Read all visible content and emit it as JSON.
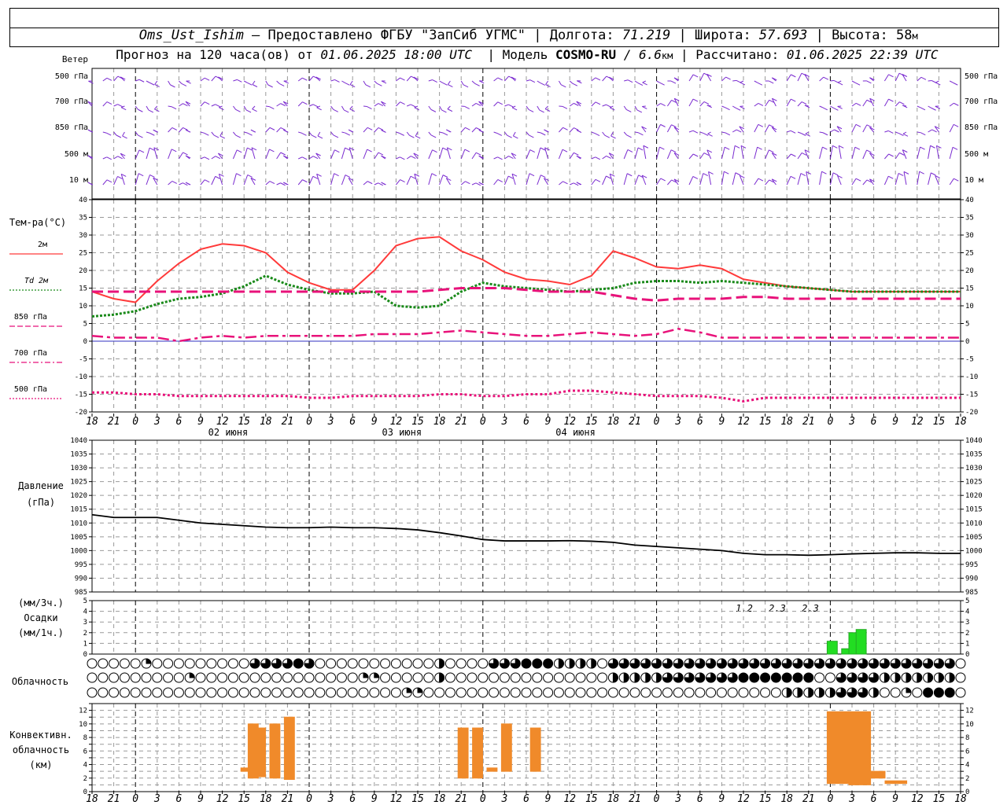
{
  "header": {
    "station": "Oms_Ust_Ishim",
    "sep1": " – ",
    "provided": "Предоставлено ФГБУ \"ЗапСиб УГМС\"",
    "lon_label": "Долгота: ",
    "lon_value": "71.219",
    "lat_label": "Широта: ",
    "lat_value": "57.693",
    "alt_label": "Высота: ",
    "alt_value": "58",
    "alt_unit": "м",
    "line2_a": "Прогноз на 120 часа(ов) от ",
    "line2_date": "01.06.2025 18:00 UTC",
    "line2_model_label": "Модель ",
    "line2_model": "COSMO-RU",
    "line2_res": " / 6.6",
    "line2_res_unit": "км",
    "line2_calc_label": "Рассчитано: ",
    "line2_calc": "01.06.2025 22:39 UTC"
  },
  "wind": {
    "title": "Ветер",
    "levels": [
      "500 гПа",
      "700 гПа",
      "850 гПа",
      "500 м",
      "10  м"
    ]
  },
  "temperature": {
    "title": "Тем-ра(°С)",
    "legend": [
      {
        "label": "2м",
        "color": "#ff3030"
      },
      {
        "label": "Td  2м",
        "color": "#1a8a1a"
      },
      {
        "label": "850 гПа",
        "color": "#e8127a"
      },
      {
        "label": "700 гПа",
        "color": "#e8127a"
      },
      {
        "label": "500 гПа",
        "color": "#e8127a"
      }
    ]
  },
  "x_axis": {
    "tick_labels": [
      "18",
      "21",
      "0",
      "3",
      "6",
      "9",
      "12",
      "15",
      "18",
      "21",
      "0",
      "3",
      "6",
      "9",
      "12",
      "15",
      "18",
      "21",
      "0",
      "3",
      "6",
      "9",
      "12",
      "15",
      "18",
      "21",
      "0"
    ],
    "days": [
      "02 июня",
      "03 июня",
      "04 июня"
    ]
  },
  "pressure": {
    "title1": "Давление",
    "title2": "(гПа)"
  },
  "precip": {
    "title1": "(мм/3ч.)",
    "title2": "Осадки",
    "title3": "(мм/1ч.)",
    "annotations": [
      "1.2",
      "2.3",
      "2.3"
    ]
  },
  "clouds": {
    "title": "Облачность"
  },
  "convective": {
    "title1": "Конвективн.",
    "title2": "облачность",
    "title3": "(км)"
  },
  "chart_data": [
    {
      "type": "line",
      "name": "temperature",
      "x_hours_from_start": [
        0,
        3,
        6,
        9,
        12,
        15,
        18,
        21,
        24,
        27,
        30,
        33,
        36,
        39,
        42,
        45,
        48,
        51,
        54,
        57,
        60,
        63,
        66,
        69,
        72,
        75,
        78,
        81,
        84,
        87,
        90,
        93,
        96,
        99,
        102,
        105,
        108,
        111,
        114,
        117,
        120
      ],
      "ylim": [
        -20,
        40
      ],
      "ylabel": "Тем-ра(°С)",
      "series": [
        {
          "name": "2м",
          "values": [
            14,
            12,
            11,
            17,
            22,
            26,
            27.5,
            27,
            25,
            19.5,
            16.5,
            14.5,
            14.5,
            20,
            27,
            29,
            29.5,
            25.5,
            23,
            19.5,
            17.5,
            17,
            16,
            18.5,
            25.5,
            23.5,
            21,
            20.5,
            21.5,
            20.5,
            17.5,
            16.5,
            15.5,
            15,
            14.5,
            14,
            14,
            14,
            14,
            14,
            14
          ]
        },
        {
          "name": "Td  2м",
          "values": [
            7,
            7.5,
            8.5,
            10.5,
            12,
            12.5,
            13.5,
            15.5,
            18.5,
            16,
            14.5,
            13.5,
            13.5,
            14,
            10,
            9.5,
            10,
            14,
            16.5,
            15.5,
            15,
            14.5,
            14,
            14.5,
            15,
            16.5,
            17,
            17,
            16.5,
            17,
            16.5,
            16,
            15.5,
            15,
            14.5,
            14,
            14,
            14,
            14,
            14,
            14
          ]
        },
        {
          "name": "850 гПа",
          "values": [
            14,
            14,
            14,
            14,
            14,
            14,
            14,
            14,
            14,
            14,
            14,
            14,
            14,
            14,
            14,
            14,
            14.5,
            15,
            15,
            15,
            14.5,
            14,
            14,
            14,
            13,
            12,
            11.5,
            12,
            12,
            12,
            12.5,
            12.5,
            12,
            12,
            12,
            12,
            12,
            12,
            12,
            12,
            12
          ]
        },
        {
          "name": "700 гПа",
          "values": [
            1.5,
            1,
            1,
            1,
            0,
            1,
            1.5,
            1,
            1.5,
            1.5,
            1.5,
            1.5,
            1.5,
            2,
            2,
            2,
            2.5,
            3,
            2.5,
            2,
            1.5,
            1.5,
            2,
            2.5,
            2,
            1.5,
            2,
            3.5,
            2.5,
            1,
            1,
            1,
            1,
            1,
            1,
            1,
            1,
            1,
            1,
            1,
            1
          ]
        },
        {
          "name": "500 гПа",
          "values": [
            -14.5,
            -14.5,
            -15,
            -15,
            -15.5,
            -15.5,
            -15.5,
            -15.5,
            -15.5,
            -15.5,
            -16,
            -16,
            -15.5,
            -15.5,
            -15.5,
            -15.5,
            -15,
            -15,
            -15.5,
            -15.5,
            -15,
            -15,
            -14,
            -14,
            -14.5,
            -15,
            -15.5,
            -15.5,
            -15.5,
            -16,
            -17,
            -16,
            -16,
            -16,
            -16,
            -16,
            -16,
            -16,
            -16,
            -16,
            -16
          ]
        }
      ]
    },
    {
      "type": "line",
      "name": "pressure",
      "x_hours_from_start": [
        0,
        3,
        6,
        9,
        12,
        15,
        18,
        21,
        24,
        27,
        30,
        33,
        36,
        39,
        42,
        45,
        48,
        51,
        54,
        57,
        60,
        63,
        66,
        69,
        72,
        75,
        78,
        81,
        84,
        87,
        90,
        93,
        96,
        99,
        102,
        105,
        108,
        111,
        114,
        117,
        120
      ],
      "ylim": [
        985,
        1040
      ],
      "values": [
        1013,
        1012,
        1012,
        1012,
        1011,
        1010,
        1009.5,
        1009,
        1008.5,
        1008.3,
        1008.3,
        1008.5,
        1008.3,
        1008.3,
        1008,
        1007.5,
        1006.5,
        1005.3,
        1004,
        1003.5,
        1003.5,
        1003.5,
        1003.6,
        1003.4,
        1003,
        1002,
        1001.5,
        1001,
        1000.5,
        1000,
        999,
        998.5,
        998.5,
        998.3,
        998.5,
        998.8,
        999,
        999.2,
        999.2,
        999,
        999
      ]
    },
    {
      "type": "bar",
      "name": "precipitation",
      "x_hours_from_start": [
        102,
        104,
        105,
        106
      ],
      "ylim": [
        0,
        5
      ],
      "values": [
        1.2,
        0.5,
        2.0,
        2.3
      ]
    },
    {
      "type": "bar",
      "name": "convective_cloud",
      "ylim": [
        0,
        13
      ],
      "ylabel": "(км)",
      "bars": [
        {
          "x": 21,
          "bottom": 3.0,
          "top": 3.5
        },
        {
          "x": 22,
          "bottom": 2.0,
          "top": 10.0
        },
        {
          "x": 23,
          "bottom": 2.2,
          "top": 9.4
        },
        {
          "x": 25,
          "bottom": 2.0,
          "top": 10.0
        },
        {
          "x": 27,
          "bottom": 1.8,
          "top": 11.0
        },
        {
          "x": 51,
          "bottom": 2.0,
          "top": 9.4
        },
        {
          "x": 53,
          "bottom": 2.0,
          "top": 9.4
        },
        {
          "x": 55,
          "bottom": 3.0,
          "top": 3.5
        },
        {
          "x": 57,
          "bottom": 3.0,
          "top": 10.0
        },
        {
          "x": 61,
          "bottom": 3.0,
          "top": 9.4
        },
        {
          "x": 102,
          "bottom": 1.2,
          "top": 11.8
        },
        {
          "x": 105,
          "bottom": 1.0,
          "top": 11.8
        },
        {
          "x": 107,
          "bottom": 2.0,
          "top": 3.0
        },
        {
          "x": 110,
          "bottom": 1.2,
          "top": 1.6
        }
      ]
    }
  ]
}
